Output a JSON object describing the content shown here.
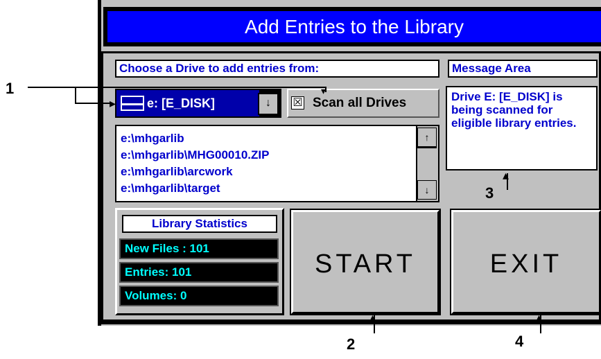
{
  "window": {
    "title": "Add Entries to the Library"
  },
  "drive_section": {
    "label": "Choose a Drive to add entries from:",
    "selected_drive": "e: [E_DISK]",
    "dropdown_arrow": "↓",
    "scan_all": {
      "label": "Scan all Drives",
      "checked": true,
      "check_glyph": "☒"
    },
    "paths": [
      "e:\\mhgarlib",
      "e:\\mhgarlib\\MHG00010.ZIP",
      "e:\\mhgarlib\\arcwork",
      "e:\\mhgarlib\\target"
    ],
    "scroll_up": "↑",
    "scroll_down": "↓"
  },
  "message_area": {
    "label": "Message Area",
    "text": "Drive E: [E_DISK] is being scanned for eligible library entries."
  },
  "stats": {
    "title": "Library Statistics",
    "new_files": "New Files :  101",
    "entries": "Entries:  101",
    "volumes": "Volumes:  0"
  },
  "buttons": {
    "start": "START",
    "exit": "EXIT"
  },
  "callouts": {
    "c1": "1",
    "c2": "2",
    "c3": "3",
    "c4": "4"
  },
  "colors": {
    "title_bar": "#0000ff",
    "panel_bg": "#c0c0c0",
    "label_text": "#0000cc",
    "stat_text": "#00ffff"
  }
}
